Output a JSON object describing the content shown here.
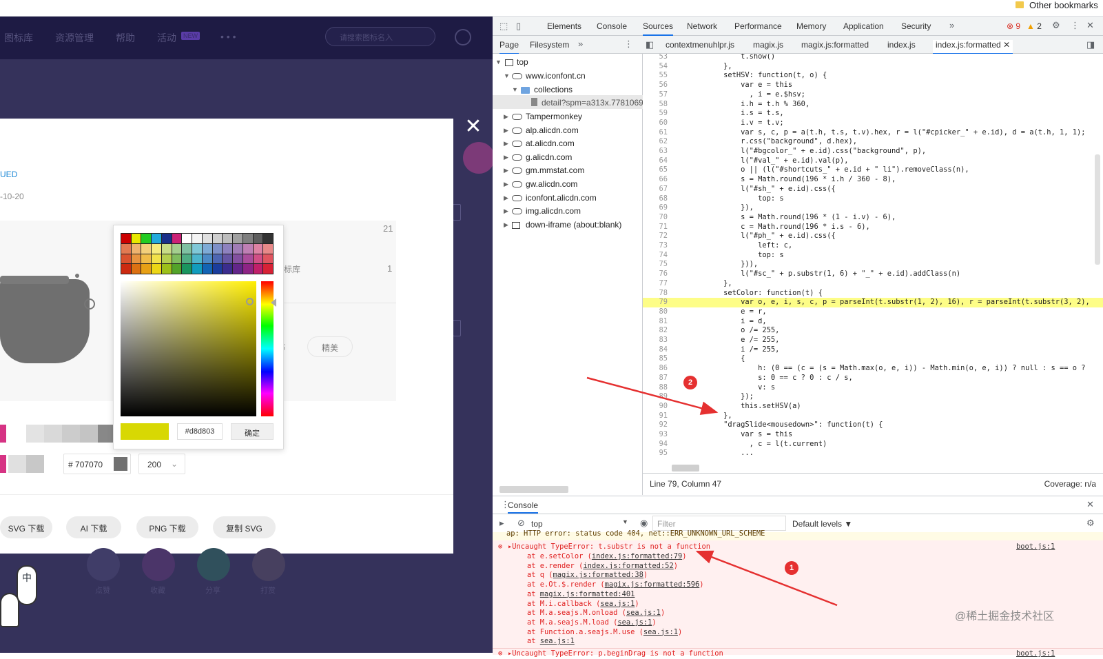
{
  "bookmarks": {
    "other_label": "Other bookmarks"
  },
  "site": {
    "nav_items": [
      "图标库",
      "资源管理",
      "帮助",
      "活动"
    ],
    "new_badge": "NEW",
    "more": "• • •",
    "search_placeholder": "请搜索图标名入"
  },
  "modal": {
    "author_label": "UED",
    "date": "-10-20",
    "stat_count_1": "21",
    "stat_label_2": "标库",
    "stat_count_2": "1",
    "tag_1": "布",
    "tag_2": "精美",
    "hex_prefix": "#",
    "hex_value": "707070",
    "size_value": "200",
    "buttons": [
      "SVG 下载",
      "AI 下载",
      "PNG 下载",
      "复制 SVG"
    ],
    "action_labels": [
      "点赞",
      "收藏",
      "分享",
      "打赏"
    ],
    "mascot_text": "中"
  },
  "picker": {
    "palette": [
      "#cc0000",
      "#e8e800",
      "#22cc22",
      "#22aadd",
      "#1a2f8a",
      "#cc2277",
      "#ffffff",
      "#f4f4f4",
      "#e0e0e0",
      "#cfcfcf",
      "#bdbdbd",
      "#a0a0a0",
      "#7f7f7f",
      "#5e5e5e",
      "#333333",
      "#e27a52",
      "#efb36f",
      "#f3cf7a",
      "#f6ec7d",
      "#c8dc86",
      "#a4cf8e",
      "#7fc1a2",
      "#80c8d8",
      "#7eabd6",
      "#7e90c8",
      "#8e82bf",
      "#a07cb6",
      "#bf7fb4",
      "#de82a4",
      "#e88989",
      "#d9522f",
      "#e89440",
      "#f0bb48",
      "#f2e24a",
      "#b4cf4e",
      "#7fbc5e",
      "#4fad83",
      "#4cb4cc",
      "#4c8ac6",
      "#4d66b3",
      "#6656a4",
      "#8350a0",
      "#aa4d9b",
      "#d14f86",
      "#e05560",
      "#cc2a10",
      "#dc7112",
      "#e7a015",
      "#ecd616",
      "#9cc01a",
      "#53a32a",
      "#1a955f",
      "#129cbd",
      "#1364b4",
      "#1b3d9c",
      "#3b2d8e",
      "#63268a",
      "#8e2485",
      "#c1206a",
      "#d82236"
    ],
    "hex": "#d8d803",
    "ok_label": "确定"
  },
  "devtools": {
    "tabs": [
      "Elements",
      "Console",
      "Sources",
      "Network",
      "Performance",
      "Memory",
      "Application",
      "Security"
    ],
    "active_tab": "Sources",
    "error_count": "9",
    "warning_count": "2",
    "nav_tabs": [
      "Page",
      "Filesystem"
    ],
    "file_tabs": [
      "contextmenuhlpr.js",
      "magix.js",
      "magix.js:formatted",
      "index.js",
      "index.js:formatted"
    ],
    "tree": {
      "top": "top",
      "origin": "www.iconfont.cn",
      "folder": "collections",
      "file": "detail?spm=a313x.7781069",
      "others": [
        "Tampermonkey",
        "alp.alicdn.com",
        "at.alicdn.com",
        "g.alicdn.com",
        "gm.mmstat.com",
        "gw.alicdn.com",
        "iconfont.alicdn.com",
        "img.alicdn.com",
        "down-iframe (about:blank)"
      ]
    },
    "code": [
      {
        "n": "53",
        "t": "                t.show()"
      },
      {
        "n": "54",
        "t": "            },"
      },
      {
        "n": "55",
        "t": "            setHSV: function(t, o) {"
      },
      {
        "n": "56",
        "t": "                var e = this"
      },
      {
        "n": "57",
        "t": "                  , i = e.$hsv;"
      },
      {
        "n": "58",
        "t": "                i.h = t.h % 360,"
      },
      {
        "n": "59",
        "t": "                i.s = t.s,"
      },
      {
        "n": "60",
        "t": "                i.v = t.v;"
      },
      {
        "n": "61",
        "t": "                var s, c, p = a(t.h, t.s, t.v).hex, r = l(\"#cpicker_\" + e.id), d = a(t.h, 1, 1);"
      },
      {
        "n": "62",
        "t": "                r.css(\"background\", d.hex),"
      },
      {
        "n": "63",
        "t": "                l(\"#bgcolor_\" + e.id).css(\"background\", p),"
      },
      {
        "n": "64",
        "t": "                l(\"#val_\" + e.id).val(p),"
      },
      {
        "n": "65",
        "t": "                o || (l(\"#shortcuts_\" + e.id + \" li\").removeClass(n),"
      },
      {
        "n": "66",
        "t": "                s = Math.round(196 * i.h / 360 - 8),"
      },
      {
        "n": "67",
        "t": "                l(\"#sh_\" + e.id).css({"
      },
      {
        "n": "68",
        "t": "                    top: s"
      },
      {
        "n": "69",
        "t": "                }),"
      },
      {
        "n": "70",
        "t": "                s = Math.round(196 * (1 - i.v) - 6),"
      },
      {
        "n": "71",
        "t": "                c = Math.round(196 * i.s - 6),"
      },
      {
        "n": "72",
        "t": "                l(\"#ph_\" + e.id).css({"
      },
      {
        "n": "73",
        "t": "                    left: c,"
      },
      {
        "n": "74",
        "t": "                    top: s"
      },
      {
        "n": "75",
        "t": "                })),"
      },
      {
        "n": "76",
        "t": "                l(\"#sc_\" + p.substr(1, 6) + \"_\" + e.id).addClass(n)"
      },
      {
        "n": "77",
        "t": "            },"
      },
      {
        "n": "78",
        "t": "            setColor: function(t) {"
      },
      {
        "n": "79",
        "t": "                var o, e, i, s, c, p = parseInt(t.substr(1, 2), 16), r = parseInt(t.substr(3, 2),"
      },
      {
        "n": "80",
        "t": "                e = r,"
      },
      {
        "n": "81",
        "t": "                i = d,"
      },
      {
        "n": "82",
        "t": "                o /= 255,"
      },
      {
        "n": "83",
        "t": "                e /= 255,"
      },
      {
        "n": "84",
        "t": "                i /= 255,"
      },
      {
        "n": "85",
        "t": "                {"
      },
      {
        "n": "86",
        "t": "                    h: (0 == (c = (s = Math.max(o, e, i)) - Math.min(o, e, i)) ? null : s == o ?"
      },
      {
        "n": "87",
        "t": "                    s: 0 == c ? 0 : c / s,"
      },
      {
        "n": "88",
        "t": "                    v: s"
      },
      {
        "n": "89",
        "t": "                });"
      },
      {
        "n": "90",
        "t": "                this.setHSV(a)"
      },
      {
        "n": "91",
        "t": "            },"
      },
      {
        "n": "92",
        "t": "            \"dragSlide<mousedown>\": function(t) {"
      },
      {
        "n": "93",
        "t": "                var s = this"
      },
      {
        "n": "94",
        "t": "                  , c = l(t.current)"
      },
      {
        "n": "95",
        "t": "                ..."
      }
    ],
    "status_position": "Line 79, Column 47",
    "coverage": "Coverage: n/a",
    "console": {
      "title": "Console",
      "context": "top",
      "filter_placeholder": "Filter",
      "levels": "Default levels ▼",
      "prev_line": "ap: HTTP error: status code 404, net::ERR_UNKNOWN_URL_SCHEME",
      "error_head": "Uncaught TypeError: t.substr is not a function",
      "error_source": "boot.js:1",
      "stack": [
        {
          "pre": "at e.setColor (",
          "link": "index.js:formatted:79",
          "post": ")"
        },
        {
          "pre": "at e.render (",
          "link": "index.js:formatted:52",
          "post": ")"
        },
        {
          "pre": "at q (",
          "link": "magix.js:formatted:38",
          "post": ")"
        },
        {
          "pre": "at e.Ot.$.render (",
          "link": "magix.js:formatted:596",
          "post": ")"
        },
        {
          "pre": "at ",
          "link": "magix.js:formatted:401",
          "post": ""
        },
        {
          "pre": "at M.i.callback (",
          "link": "sea.js:1",
          "post": ")"
        },
        {
          "pre": "at M.a.seajs.M.onload (",
          "link": "sea.js:1",
          "post": ")"
        },
        {
          "pre": "at M.a.seajs.M.load (",
          "link": "sea.js:1",
          "post": ")"
        },
        {
          "pre": "at Function.a.seajs.M.use (",
          "link": "sea.js:1",
          "post": ")"
        },
        {
          "pre": "at ",
          "link": "sea.js:1",
          "post": ""
        }
      ],
      "next_error": "Uncaught TypeError: p.beginDrag is not a function",
      "next_source": "boot.js:1"
    },
    "annotation_1": "1",
    "annotation_2": "2"
  },
  "watermark": "@稀土掘金技术社区",
  "colors": {
    "site_bg": "#35325b",
    "highlight": "#fdfd87",
    "error_bg": "#fff0f0",
    "arrow": "#e53030"
  }
}
